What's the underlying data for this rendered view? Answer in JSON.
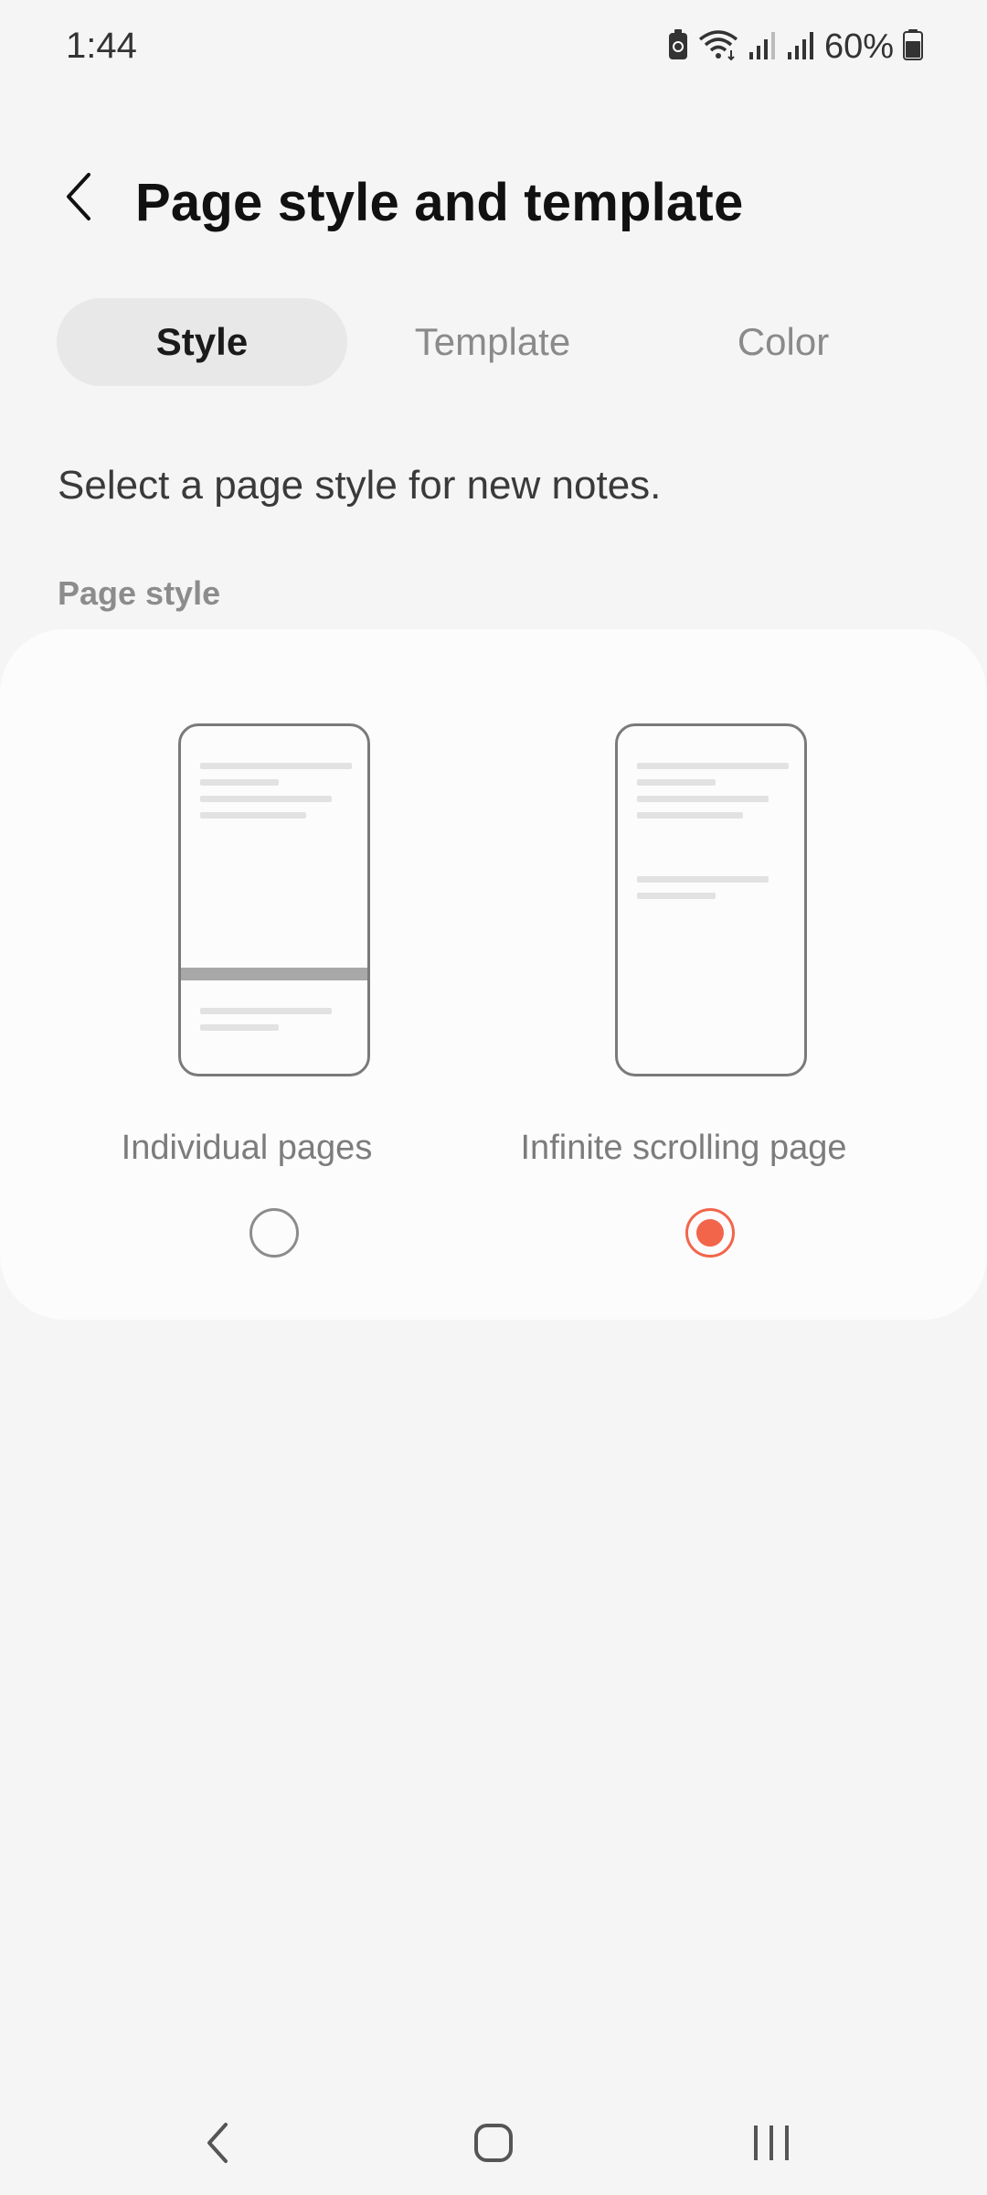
{
  "status_bar": {
    "time": "1:44",
    "battery_percent": "60%",
    "icons": [
      "battery-saver-icon",
      "wifi-icon",
      "signal-icon",
      "signal-icon",
      "battery-icon"
    ]
  },
  "app_bar": {
    "back_icon": "back-arrow-icon",
    "title": "Page style and template"
  },
  "tabs": [
    {
      "label": "Style",
      "active": true
    },
    {
      "label": "Template",
      "active": false
    },
    {
      "label": "Color",
      "active": false
    }
  ],
  "description": "Select a page style for new notes.",
  "section_label": "Page style",
  "options": [
    {
      "label": "Individual pages",
      "selected": false
    },
    {
      "label": "Infinite scrolling page",
      "selected": true
    }
  ],
  "colors": {
    "accent": "#f2654b",
    "background": "#f5f5f5",
    "card": "#fcfcfc"
  },
  "nav_bar": {
    "icons": [
      "nav-back-icon",
      "nav-home-icon",
      "nav-recents-icon"
    ]
  }
}
